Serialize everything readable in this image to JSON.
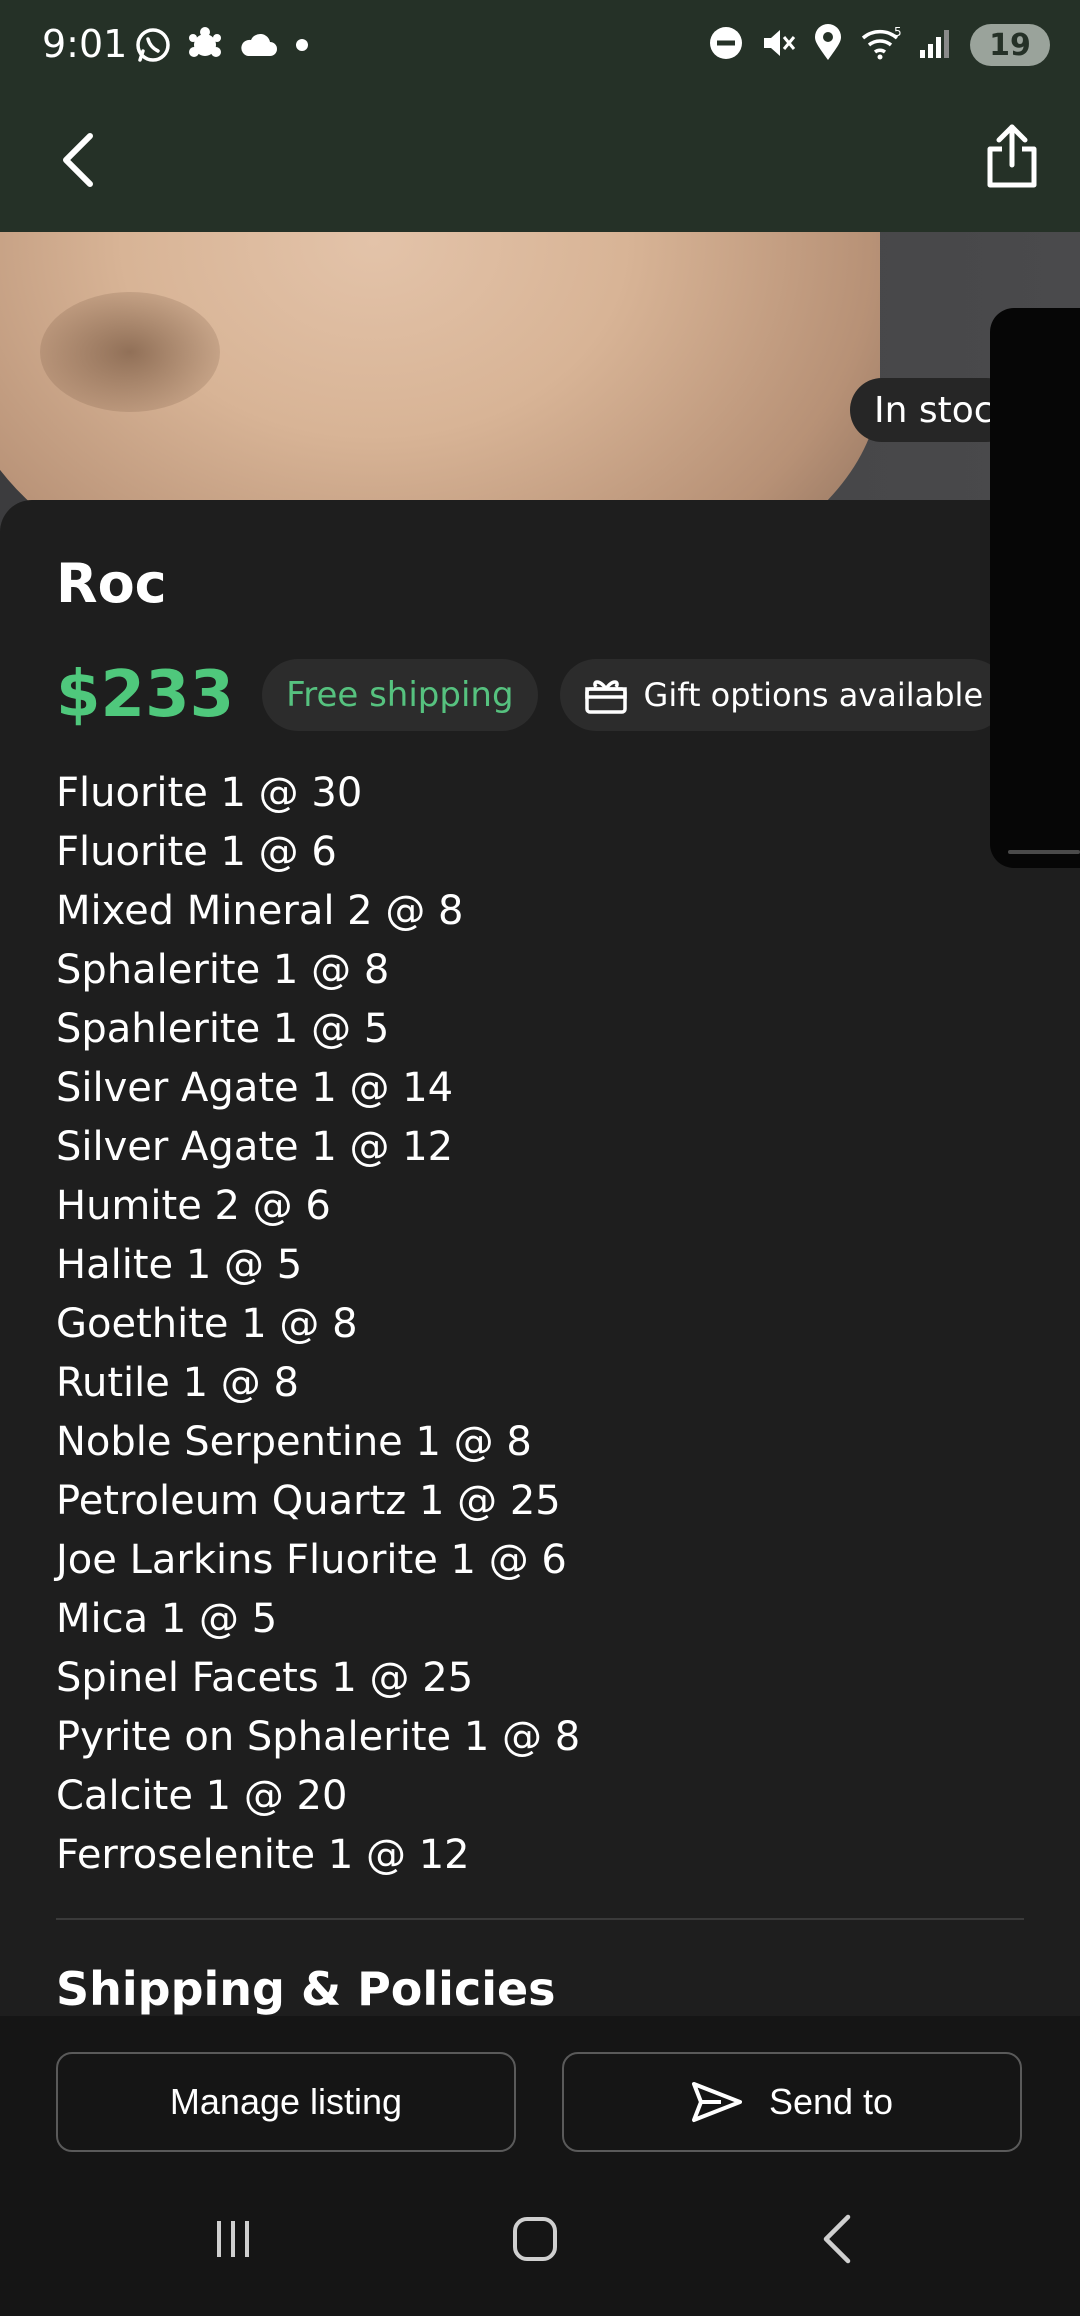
{
  "status_bar": {
    "time": "9:01",
    "battery": "19",
    "left_icons": [
      "whatsapp-icon",
      "settings-icon",
      "cloud-icon",
      "dot-icon"
    ],
    "right_icons": [
      "dnd-icon",
      "mute-icon",
      "location-icon",
      "wifi-icon",
      "signal-icon"
    ]
  },
  "app_bar": {
    "back_icon": "chevron-left-icon",
    "share_icon": "share-icon"
  },
  "hero": {
    "stock_badge": "In stoc"
  },
  "listing": {
    "title": "Roc",
    "price": "$233",
    "shipping_chip": "Free shipping",
    "gift_chip": "Gift options available",
    "items": [
      "Fluorite 1 @ 30",
      "Fluorite 1 @ 6",
      "Mixed Mineral 2 @ 8",
      "Sphalerite 1 @ 8",
      "Spahlerite 1 @ 5",
      "Silver Agate 1 @ 14",
      "Silver Agate 1 @ 12",
      "Humite 2 @ 6",
      "Halite 1 @ 5",
      "Goethite 1 @ 8",
      "Rutile 1 @ 8",
      "Noble Serpentine 1 @ 8",
      "Petroleum Quartz 1 @ 25",
      "Joe Larkins Fluorite 1 @ 6",
      "Mica 1 @ 5",
      "Spinel Facets 1 @ 25",
      "Pyrite on Sphalerite 1 @ 8",
      "Calcite 1 @ 20",
      "Ferroselenite 1 @ 12"
    ],
    "section_title": "Shipping & Policies"
  },
  "actions": {
    "manage_label": "Manage listing",
    "send_label": "Send to"
  },
  "colors": {
    "header_bg": "#253127",
    "price": "#4fc87c",
    "shipping": "#56c27f",
    "sheet_bg": "#1e1e1e"
  }
}
